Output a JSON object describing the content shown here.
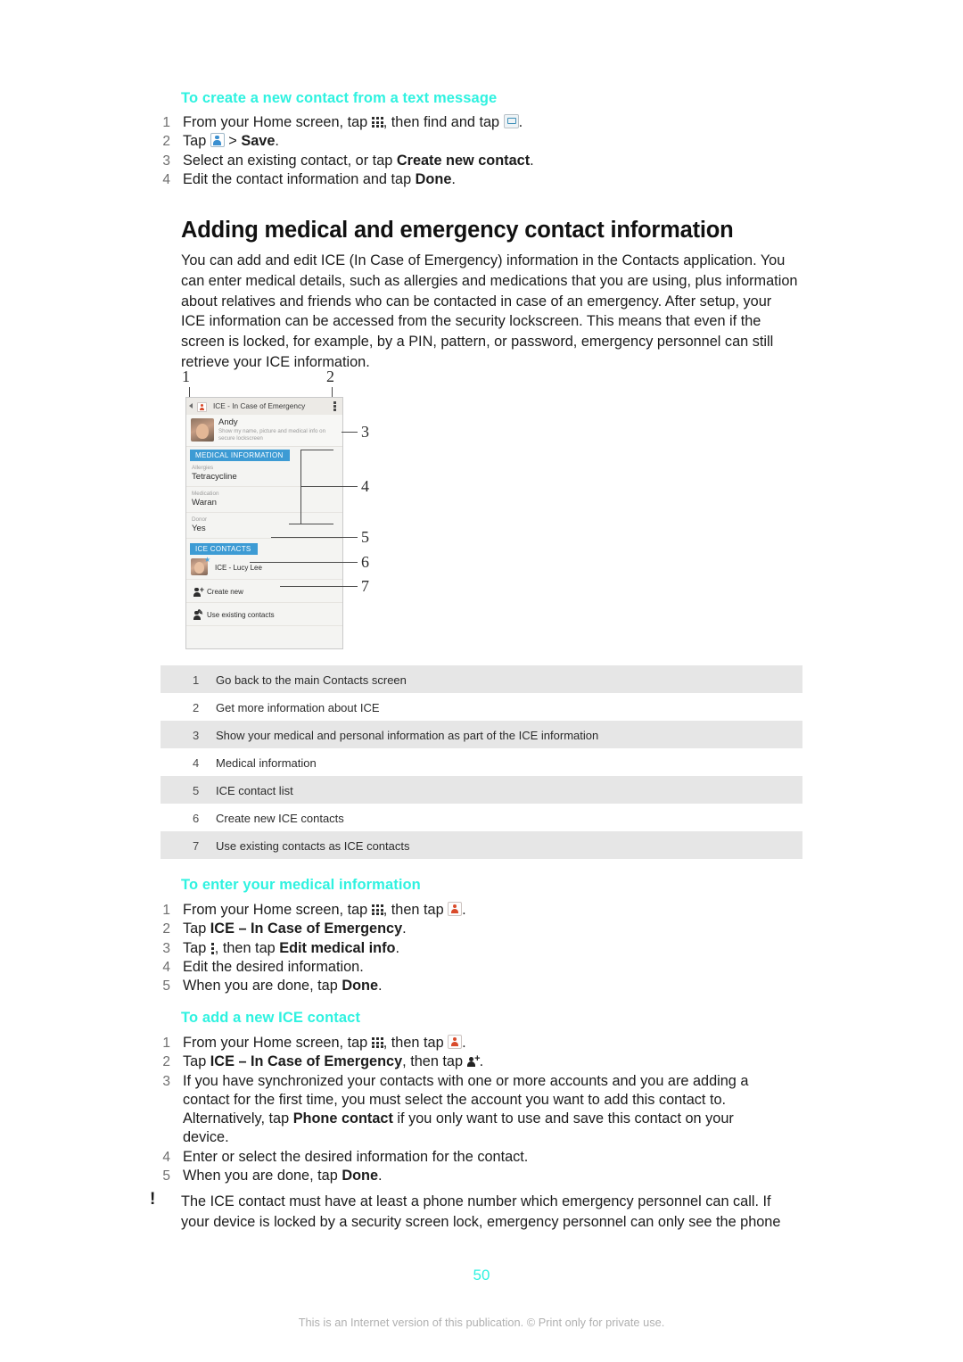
{
  "sections": {
    "create_from_text": {
      "heading": "To create a new contact from a text message",
      "steps": {
        "s1_a": "From your Home screen, tap ",
        "s1_b": ", then find and tap ",
        "s1_c": ".",
        "s2_a": "Tap ",
        "s2_b": " > ",
        "s2_bold": "Save",
        "s2_c": ".",
        "s3_a": "Select an existing contact, or tap ",
        "s3_bold": "Create new contact",
        "s3_b": ".",
        "s4_a": "Edit the contact information and tap ",
        "s4_bold": "Done",
        "s4_b": "."
      }
    },
    "main": {
      "title": "Adding medical and emergency contact information",
      "paragraph": "You can add and edit ICE (In Case of Emergency) information in the Contacts application. You can enter medical details, such as allergies and medications that you are using, plus information about relatives and friends who can be contacted in case of an emergency. After setup, your ICE information can be accessed from the security lockscreen. This means that even if the screen is locked, for example, by a PIN, pattern, or password, emergency personnel can still retrieve your ICE information."
    },
    "enter_medical": {
      "heading": "To enter your medical information",
      "steps": {
        "s1_a": "From your Home screen, tap ",
        "s1_b": ", then tap ",
        "s1_c": ".",
        "s2_a": "Tap ",
        "s2_bold": "ICE – In Case of Emergency",
        "s2_b": ".",
        "s3_a": "Tap ",
        "s3_b": ", then tap ",
        "s3_bold": "Edit medical info",
        "s3_c": ".",
        "s4": "Edit the desired information.",
        "s5_a": "When you are done, tap ",
        "s5_bold": "Done",
        "s5_b": "."
      }
    },
    "add_ice_contact": {
      "heading": "To add a new ICE contact",
      "steps": {
        "s1_a": "From your Home screen, tap ",
        "s1_b": ", then tap ",
        "s1_c": ".",
        "s2_a": "Tap ",
        "s2_bold": "ICE – In Case of Emergency",
        "s2_b": ", then tap ",
        "s2_c": ".",
        "s3_a": "If you have synchronized your contacts with one or more accounts and you are adding a contact for the first time, you must select the account you want to add this contact to. Alternatively, tap ",
        "s3_bold": "Phone contact",
        "s3_b": " if you only want to use and save this contact on your device.",
        "s4": "Enter or select the desired information for the contact.",
        "s5_a": "When you are done, tap ",
        "s5_bold": "Done",
        "s5_b": "."
      }
    }
  },
  "figure": {
    "callouts": [
      "1",
      "2",
      "3",
      "4",
      "5",
      "6",
      "7"
    ],
    "phone": {
      "appbar_title": "ICE - In Case of Emergency",
      "profile_name": "Andy",
      "profile_sub": "Show my name, picture and medical info on secure lockscreen",
      "section_medical": "MEDICAL INFORMATION",
      "fields": [
        {
          "label": "Allergies",
          "value": "Tetracycline"
        },
        {
          "label": "Medication",
          "value": "Waran"
        },
        {
          "label": "Donor",
          "value": "Yes"
        }
      ],
      "section_contacts": "ICE CONTACTS",
      "contact_name": "ICE - Lucy Lee",
      "create_new": "Create new",
      "use_existing": "Use existing contacts"
    }
  },
  "legend": {
    "rows": [
      {
        "num": "1",
        "text": "Go back to the main Contacts screen"
      },
      {
        "num": "2",
        "text": "Get more information about ICE"
      },
      {
        "num": "3",
        "text": "Show your medical and personal information as part of the ICE information"
      },
      {
        "num": "4",
        "text": "Medical information"
      },
      {
        "num": "5",
        "text": "ICE contact list"
      },
      {
        "num": "6",
        "text": "Create new ICE contacts"
      },
      {
        "num": "7",
        "text": "Use existing contacts as ICE contacts"
      }
    ]
  },
  "note": {
    "marker": "!",
    "text": "The ICE contact must have at least a phone number which emergency personnel can call. If your device is locked by a security screen lock, emergency personnel can only see the phone"
  },
  "footer": {
    "page_number": "50",
    "disclaimer": "This is an Internet version of this publication. © Print only for private use."
  },
  "colors": {
    "accent_teal": "#2ff2e0",
    "legend_shade": "#e6e6e6",
    "phone_section_blue": "#3d9bd4"
  }
}
